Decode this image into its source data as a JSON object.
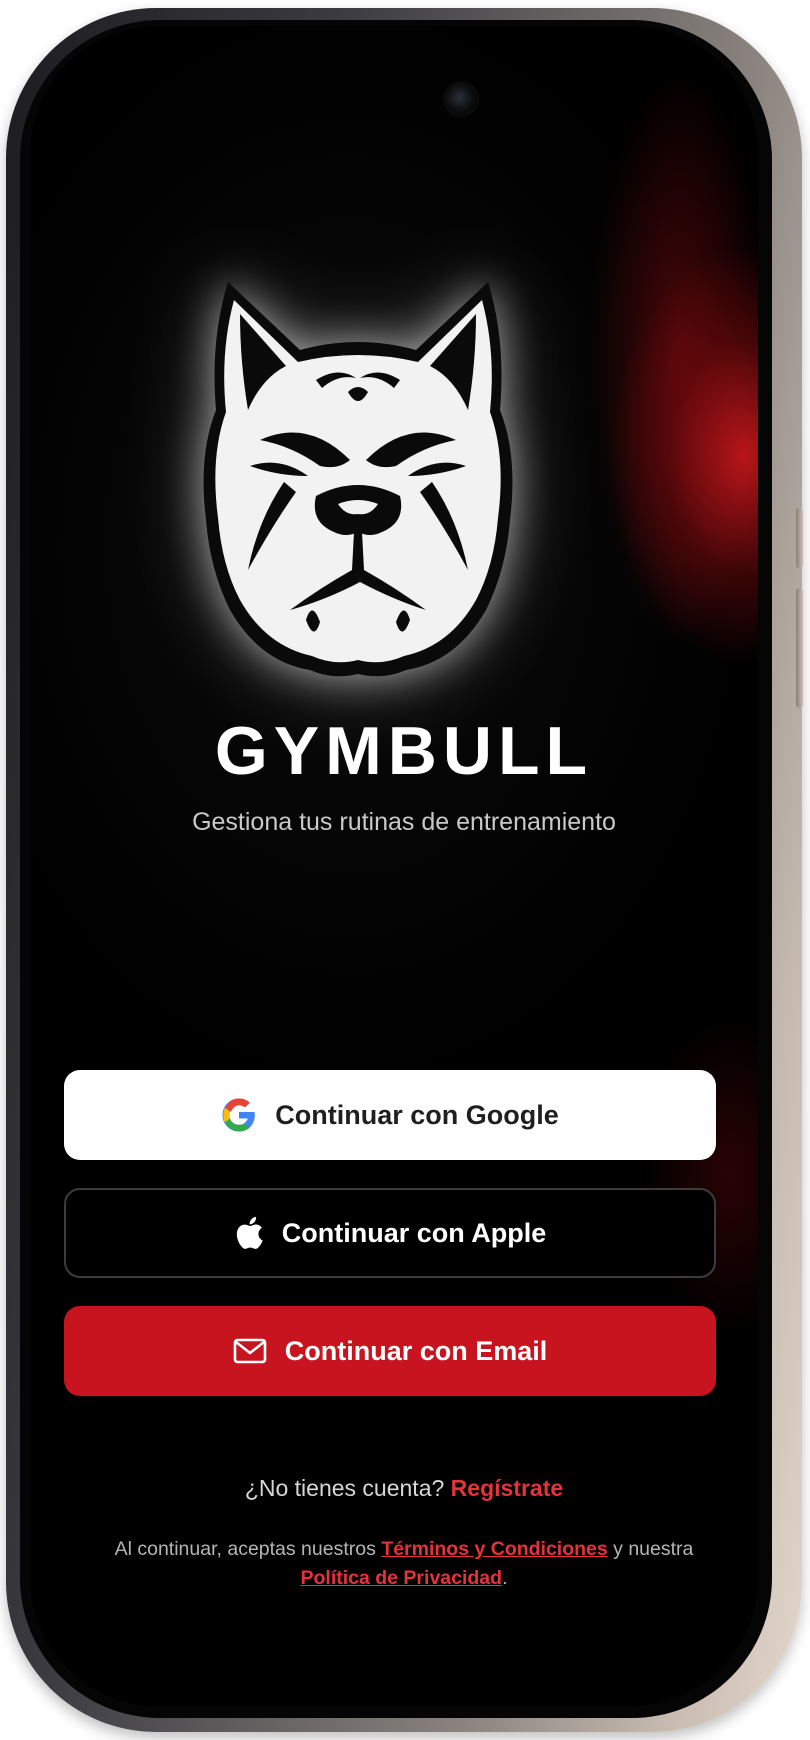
{
  "app": {
    "title": "GYMBULL",
    "subtitle": "Gestiona tus rutinas de entrenamiento",
    "logo_icon": "bulldog-head-icon"
  },
  "auth_buttons": {
    "google": {
      "label": "Continuar con Google",
      "icon": "google-icon"
    },
    "apple": {
      "label": "Continuar con Apple",
      "icon": "apple-icon"
    },
    "email": {
      "label": "Continuar con Email",
      "icon": "mail-icon"
    }
  },
  "signup": {
    "prompt": "¿No tienes cuenta?",
    "link": "Regístrate"
  },
  "legal": {
    "prefix": "Al continuar, aceptas nuestros",
    "terms_link": "Términos y Condiciones",
    "middle": "y nuestra",
    "privacy_link": "Política de Privacidad",
    "suffix": "."
  },
  "colors": {
    "background": "#000000",
    "accent": "#c8141e",
    "link": "#e5323b",
    "button_light": "#ffffff"
  }
}
